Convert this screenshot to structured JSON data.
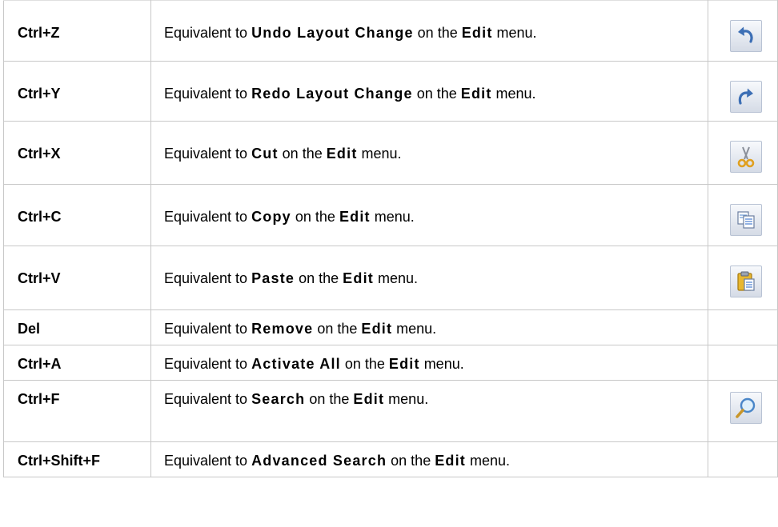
{
  "shortcuts": [
    {
      "key": "Ctrl+Z",
      "prefix": "Equivalent to ",
      "command": "Undo Layout Change",
      "mid": " on the ",
      "menu": "Edit",
      "suffix": " menu.",
      "icon": "undo-icon"
    },
    {
      "key": "Ctrl+Y",
      "prefix": "Equivalent to ",
      "command": "Redo Layout Change",
      "mid": " on the ",
      "menu": "Edit",
      "suffix": " menu.",
      "icon": "redo-icon"
    },
    {
      "key": "Ctrl+X",
      "prefix": "Equivalent to ",
      "command": "Cut",
      "mid": " on the ",
      "menu": "Edit",
      "suffix": " menu.",
      "icon": "cut-icon"
    },
    {
      "key": "Ctrl+C",
      "prefix": "Equivalent to ",
      "command": "Copy",
      "mid": " on the ",
      "menu": "Edit",
      "suffix": " menu.",
      "icon": "copy-icon"
    },
    {
      "key": "Ctrl+V",
      "prefix": "Equivalent to ",
      "command": "Paste",
      "mid": " on the ",
      "menu": "Edit",
      "suffix": " menu.",
      "icon": "paste-icon"
    },
    {
      "key": "Del",
      "prefix": "Equivalent to ",
      "command": "Remove",
      "mid": " on the ",
      "menu": "Edit",
      "suffix": " menu.",
      "icon": ""
    },
    {
      "key": "Ctrl+A",
      "prefix": "Equivalent to ",
      "command": "Activate All",
      "mid": " on the ",
      "menu": "Edit",
      "suffix": " menu.",
      "icon": ""
    },
    {
      "key": "Ctrl+F",
      "prefix": "Equivalent to ",
      "command": "Search",
      "mid": " on the ",
      "menu": "Edit",
      "suffix": " menu.",
      "icon": "search-icon"
    },
    {
      "key": "Ctrl+Shift+F",
      "prefix": "Equivalent to ",
      "command": "Advanced Search",
      "mid": " on the ",
      "menu": "Edit",
      "suffix": " menu.",
      "icon": ""
    }
  ],
  "colors": {
    "border": "#c8c8c8",
    "icon_blue": "#3d6fb5",
    "icon_yellow": "#e8b730"
  }
}
